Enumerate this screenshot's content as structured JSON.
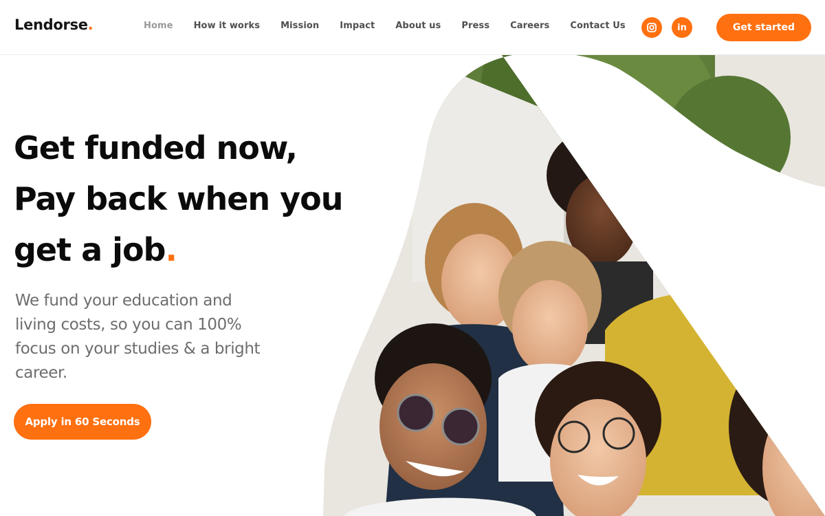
{
  "brand": {
    "name": "Lendorse",
    "dot": ".",
    "accent": "#ff7010"
  },
  "nav": {
    "items": [
      {
        "label": "Home",
        "active": true
      },
      {
        "label": "How it works",
        "active": false
      },
      {
        "label": "Mission",
        "active": false
      },
      {
        "label": "Impact",
        "active": false
      },
      {
        "label": "About us",
        "active": false
      },
      {
        "label": "Press",
        "active": false
      },
      {
        "label": "Careers",
        "active": false
      },
      {
        "label": "Contact Us",
        "active": false
      }
    ],
    "social": [
      {
        "icon": "instagram-icon"
      },
      {
        "icon": "linkedin-icon",
        "glyph": "in"
      }
    ],
    "cta_label": "Get started"
  },
  "hero": {
    "headline_line1": "Get funded now,",
    "headline_line2": "Pay back when you",
    "headline_line3": "get a job",
    "headline_dot": ".",
    "subtext": "We fund your education and living costs, so you can 100% focus on your studies & a bright career.",
    "cta_label": "Apply in 60 Seconds",
    "image": "group-of-smiling-students-photo"
  }
}
